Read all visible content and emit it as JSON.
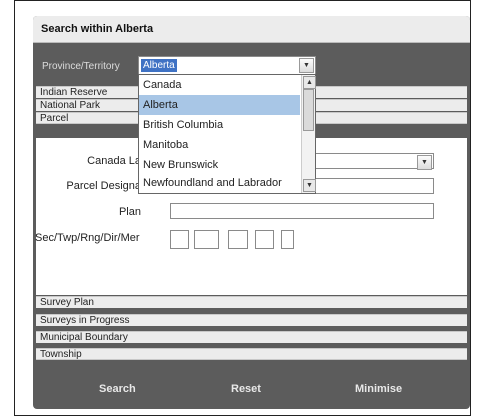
{
  "dialog": {
    "title": "Search within Alberta",
    "province_label": "Province/Territory",
    "province_value": "Alberta"
  },
  "province_options": [
    "Canada",
    "Alberta",
    "British Columbia",
    "Manitoba",
    "New Brunswick",
    "Newfoundland and Labrador"
  ],
  "selected_option": "Alberta",
  "sections_top": [
    "Indian Reserve",
    "National Park",
    "Parcel"
  ],
  "sections_bottom": [
    "Survey Plan",
    "Surveys in Progress",
    "Municipal Boundary",
    "Township"
  ],
  "parcel": {
    "canada_lands_label": "Canada La",
    "parcel_designation_label": "Parcel Designa",
    "plan_label": "Plan",
    "sec_label": "Sec/Twp/Rng/Dir/Mer"
  },
  "actions": {
    "search": "Search",
    "reset": "Reset",
    "minimise": "Minimise"
  },
  "icons": {
    "dropdown": "chevron-down-icon",
    "scroll_up": "scroll-up-icon",
    "scroll_down": "scroll-down-icon"
  }
}
